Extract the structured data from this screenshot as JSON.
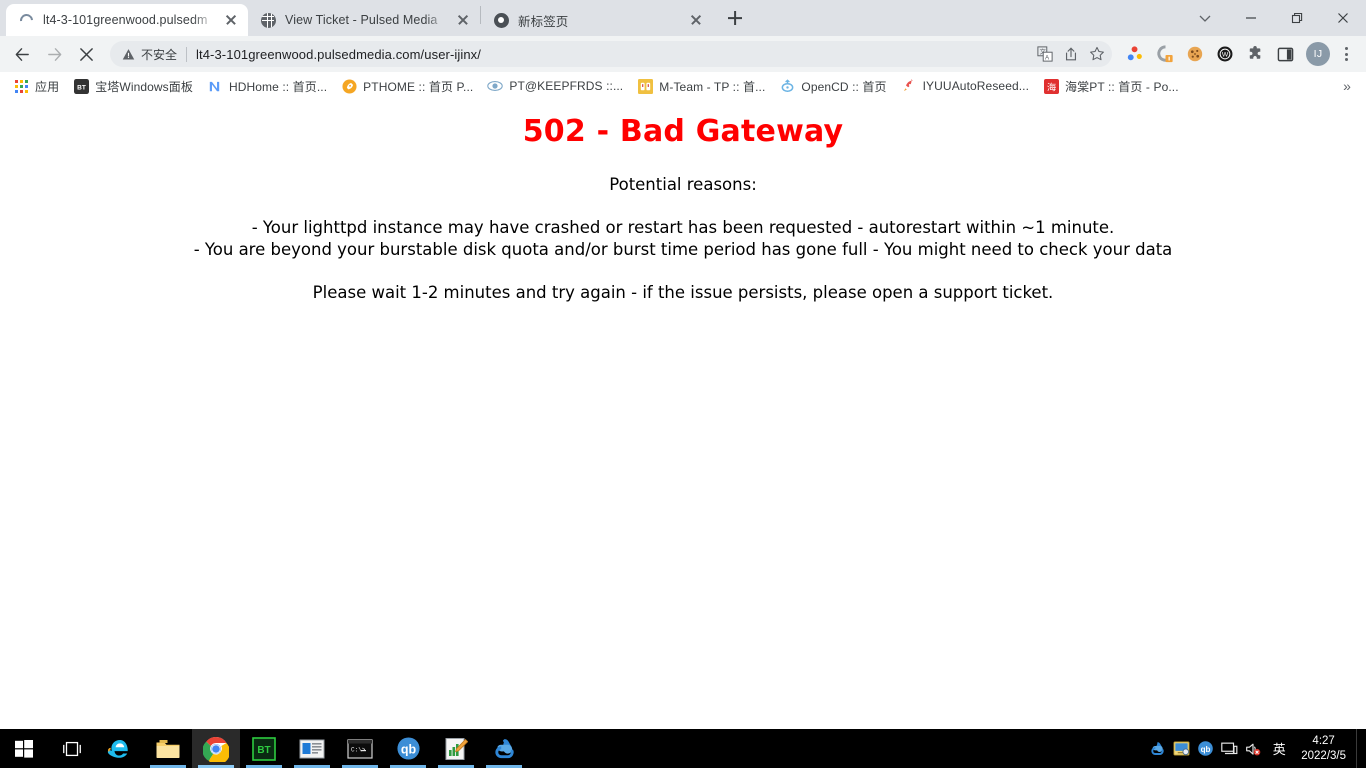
{
  "window": {
    "controls": {
      "tab_search": "Search tabs",
      "minimize": "Minimize",
      "restore": "Restore",
      "close": "Close"
    }
  },
  "tabs": [
    {
      "title": "lt4-3-101greenwood.pulsedm",
      "favicon": "loading-spinner-icon",
      "active": true
    },
    {
      "title": "View Ticket - Pulsed Media",
      "favicon": "globe-icon",
      "active": false
    },
    {
      "title": "新标签页",
      "favicon": "chrome-icon",
      "active": false
    }
  ],
  "newtab_label": "+",
  "toolbar": {
    "back": "Back",
    "forward": "Forward",
    "stop": "Stop",
    "security_label": "不安全",
    "url": "lt4-3-101greenwood.pulsedmedia.com/user-ijinx/",
    "url_host": "lt4-3-101greenwood.pulsedmedia.com",
    "url_path": "/user-ijinx/",
    "translate": "translate-icon",
    "share": "share-icon",
    "bookmark_star": "star-icon",
    "extensions": [
      {
        "name": "colorful-dots-extension-icon"
      },
      {
        "name": "q-badge-extension-icon"
      },
      {
        "name": "cookie-extension-icon"
      },
      {
        "name": "w-circle-extension-icon"
      },
      {
        "name": "puzzle-extensions-icon"
      },
      {
        "name": "side-panel-icon"
      }
    ],
    "avatar_initials": "IJ",
    "menu": "chrome-menu-icon"
  },
  "bookmarks": {
    "items": [
      {
        "label": "应用",
        "icon": "apps-grid-icon"
      },
      {
        "label": "宝塔Windows面板",
        "icon": "bt-icon"
      },
      {
        "label": "HDHome :: 首页...",
        "icon": "hdhome-icon"
      },
      {
        "label": "PTHOME :: 首页 P...",
        "icon": "pthome-icon"
      },
      {
        "label": "PT@KEEPFRDS ::...",
        "icon": "keepfrds-icon"
      },
      {
        "label": "M-Team - TP :: 首...",
        "icon": "mteam-icon"
      },
      {
        "label": "OpenCD :: 首页",
        "icon": "opencd-icon"
      },
      {
        "label": "IYUUAutoReseed...",
        "icon": "rocket-icon"
      },
      {
        "label": "海棠PT :: 首页 - Po...",
        "icon": "haitangpt-icon"
      }
    ],
    "overflow": "»"
  },
  "page": {
    "heading": "502 - Bad Gateway",
    "lead": "Potential reasons:",
    "reason_1": "- Your lighttpd instance may have crashed or restart has been requested - autorestart within ~1 minute.",
    "reason_2": "- You are beyond your burstable disk quota and/or burst time period has gone full - You might need to check your data",
    "footer": "Please wait 1-2 minutes and try again - if the issue persists, please open a support ticket.",
    "heading_color": "#ff0000",
    "text_color": "#000000"
  },
  "taskbar": {
    "items": [
      {
        "name": "start-button",
        "icon": "windows-logo-icon",
        "running": false,
        "active": false
      },
      {
        "name": "task-view-button",
        "icon": "task-view-icon",
        "running": false,
        "active": false
      },
      {
        "name": "internet-explorer-button",
        "icon": "internet-explorer-icon",
        "running": false,
        "active": false
      },
      {
        "name": "file-explorer-button",
        "icon": "folder-icon",
        "running": true,
        "active": false
      },
      {
        "name": "chrome-button",
        "icon": "chrome-icon",
        "running": true,
        "active": true
      },
      {
        "name": "baota-button",
        "icon": "bt-icon",
        "running": true,
        "active": false
      },
      {
        "name": "news-app-button",
        "icon": "news-panel-icon",
        "running": true,
        "active": false
      },
      {
        "name": "command-prompt-button",
        "icon": "terminal-icon",
        "running": true,
        "active": false
      },
      {
        "name": "qbittorrent-button",
        "icon": "qb-icon",
        "running": true,
        "active": false
      },
      {
        "name": "editor-button",
        "icon": "chart-editor-icon",
        "running": true,
        "active": false
      },
      {
        "name": "resilio-button",
        "icon": "swirl-icon",
        "running": true,
        "active": false
      }
    ],
    "tray": [
      {
        "name": "resilio-tray-icon"
      },
      {
        "name": "network-share-tray-icon"
      },
      {
        "name": "qbittorrent-tray-icon"
      },
      {
        "name": "network-monitor-tray-icon"
      },
      {
        "name": "volume-muted-tray-icon"
      }
    ],
    "ime": "英",
    "time": "4:27",
    "date": "2022/3/5"
  }
}
